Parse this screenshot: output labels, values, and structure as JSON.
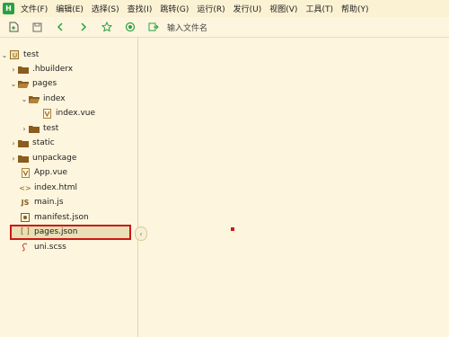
{
  "app": {
    "logo_text": "H"
  },
  "menu": [
    "文件(F)",
    "编辑(E)",
    "选择(S)",
    "查找(I)",
    "跳转(G)",
    "运行(R)",
    "发行(U)",
    "视图(V)",
    "工具(T)",
    "帮助(Y)"
  ],
  "toolbar": {
    "search_placeholder": "输入文件名"
  },
  "tree": [
    {
      "label": "test",
      "caret": "down",
      "icon": "project-icon"
    },
    {
      "label": ".hbuilderx",
      "caret": "right",
      "icon": "folder-icon"
    },
    {
      "label": "pages",
      "caret": "down",
      "icon": "folder-open-icon"
    },
    {
      "label": "index",
      "caret": "down",
      "icon": "folder-open-icon"
    },
    {
      "label": "index.vue",
      "caret": "",
      "icon": "vue-file-icon"
    },
    {
      "label": "test",
      "caret": "right",
      "icon": "folder-icon"
    },
    {
      "label": "static",
      "caret": "right",
      "icon": "folder-icon"
    },
    {
      "label": "unpackage",
      "caret": "right",
      "icon": "folder-icon"
    },
    {
      "label": "App.vue",
      "caret": "",
      "icon": "vue-file-icon"
    },
    {
      "label": "index.html",
      "caret": "",
      "icon": "html-file-icon"
    },
    {
      "label": "main.js",
      "caret": "",
      "icon": "js-file-icon"
    },
    {
      "label": "manifest.json",
      "caret": "",
      "icon": "manifest-file-icon"
    },
    {
      "label": "pages.json",
      "caret": "",
      "icon": "json-file-icon"
    },
    {
      "label": "uni.scss",
      "caret": "",
      "icon": "scss-file-icon"
    }
  ],
  "colors": {
    "accent_green": "#27a243",
    "highlight_red": "#cc1616",
    "bg": "#fdf5dd"
  }
}
